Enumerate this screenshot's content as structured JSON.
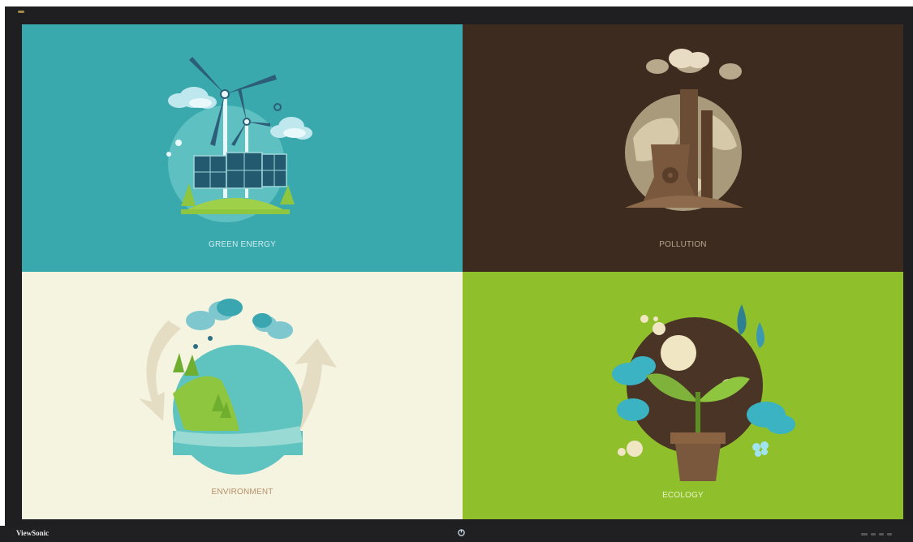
{
  "brand": "ViewSonic",
  "tiles": [
    {
      "label": "GREEN ENERGY",
      "background": "#39a9ad",
      "icon": "wind-solar-icon"
    },
    {
      "label": "POLLUTION",
      "background": "#3d2b1f",
      "icon": "factory-icon"
    },
    {
      "label": "ENVIRONMENT",
      "background": "#f5f4e1",
      "icon": "water-cycle-icon"
    },
    {
      "label": "ECOLOGY",
      "background": "#8fbf2a",
      "icon": "plant-pot-icon"
    }
  ]
}
